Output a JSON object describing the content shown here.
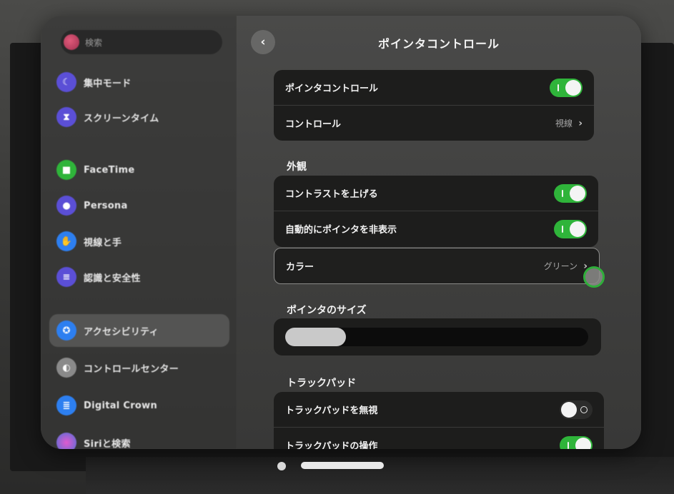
{
  "sidebar": {
    "search_placeholder": "検索",
    "items": [
      {
        "label": "集中モード",
        "icon": "moon-icon",
        "color": "#5b4fd6"
      },
      {
        "label": "スクリーンタイム",
        "icon": "hourglass-icon",
        "color": "#5b4fd6"
      },
      {
        "label": "FaceTime",
        "icon": "video-icon",
        "color": "#2fb43a"
      },
      {
        "label": "Persona",
        "icon": "persona-icon",
        "color": "#5b4fd6"
      },
      {
        "label": "視線と手",
        "icon": "hand-icon",
        "color": "#2d7ff0"
      },
      {
        "label": "認識と安全性",
        "icon": "shield-list-icon",
        "color": "#5b4fd6"
      },
      {
        "label": "アクセシビリティ",
        "icon": "accessibility-icon",
        "color": "#2d7ff0"
      },
      {
        "label": "コントロールセンター",
        "icon": "control-center-icon",
        "color": "#8a8a8a"
      },
      {
        "label": "Digital Crown",
        "icon": "digital-crown-icon",
        "color": "#2d7ff0"
      },
      {
        "label": "Siriと検索",
        "icon": "siri-icon",
        "color": "#c04fd6"
      }
    ]
  },
  "header": {
    "title": "ポインタコントロール",
    "back_icon": "chevron-left-icon"
  },
  "groups": {
    "main": {
      "pointer_control_label": "ポインタコントロール",
      "pointer_control_on": true,
      "control_label": "コントロール",
      "control_value": "視線"
    },
    "appearance": {
      "title": "外観",
      "contrast_label": "コントラストを上げる",
      "contrast_on": true,
      "autohide_label": "自動的にポインタを非表示",
      "autohide_on": true,
      "color_label": "カラー",
      "color_value": "グリーン"
    },
    "size": {
      "title": "ポインタのサイズ",
      "slider_value": 0.2
    },
    "trackpad": {
      "title": "トラックパッド",
      "ignore_label": "トラックパッドを無視",
      "ignore_on": false,
      "operation_label": "トラックパッドの操作",
      "operation_on": true
    }
  },
  "colors": {
    "toggle_on": "#2fb43a",
    "pointer_ring": "#2fae3a"
  }
}
